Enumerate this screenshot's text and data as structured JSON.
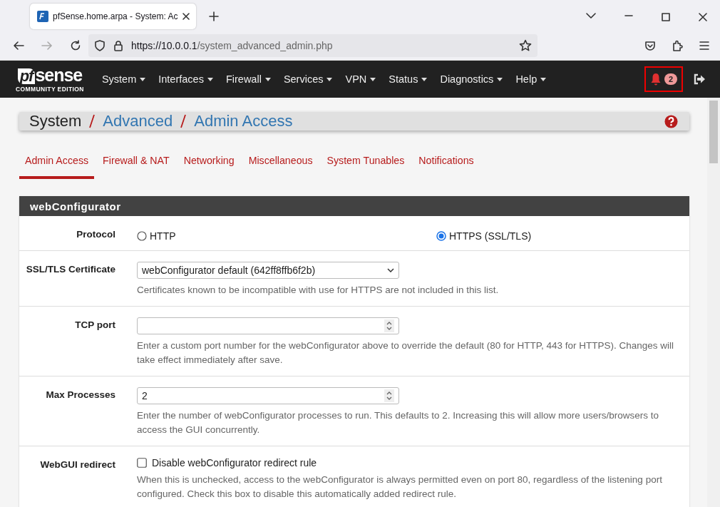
{
  "browser": {
    "tab_title": "pfSense.home.arpa - System: Ac",
    "url_host": "https://10.0.0.1",
    "url_path": "/system_advanced_admin.php"
  },
  "logo": {
    "mark": "pf",
    "word": "sense",
    "subtitle": "COMMUNITY EDITION"
  },
  "nav": {
    "menus": [
      "System",
      "Interfaces",
      "Firewall",
      "Services",
      "VPN",
      "Status",
      "Diagnostics",
      "Help"
    ],
    "notifications": "2"
  },
  "breadcrumb": [
    {
      "label": "System",
      "kind": "text"
    },
    {
      "label": "Advanced",
      "kind": "link"
    },
    {
      "label": "Admin Access",
      "kind": "link"
    }
  ],
  "tabs": [
    {
      "label": "Admin Access",
      "selected": true
    },
    {
      "label": "Firewall & NAT",
      "selected": false
    },
    {
      "label": "Networking",
      "selected": false
    },
    {
      "label": "Miscellaneous",
      "selected": false
    },
    {
      "label": "System Tunables",
      "selected": false
    },
    {
      "label": "Notifications",
      "selected": false
    }
  ],
  "section": {
    "title": "webConfigurator",
    "rows": [
      {
        "kind": "radio",
        "label": "Protocol",
        "options": [
          {
            "label": "HTTP",
            "selected": false
          },
          {
            "label": "HTTPS (SSL/TLS)",
            "selected": true
          }
        ]
      },
      {
        "kind": "select",
        "label": "SSL/TLS Certificate",
        "value": "webConfigurator default (642ff8ffb6f2b)",
        "help": "Certificates known to be incompatible with use for HTTPS are not included in this list."
      },
      {
        "kind": "number",
        "label": "TCP port",
        "help": "Enter a custom port number for the webConfigurator above to override the default (80 for HTTP, 443 for HTTPS). Changes will take effect immediately after save."
      },
      {
        "kind": "number",
        "label": "Max Processes",
        "value": "2",
        "help": "Enter the number of webConfigurator processes to run. This defaults to 2. Increasing this will allow more users/browsers to access the GUI concurrently."
      },
      {
        "kind": "checkbox",
        "label": "WebGUI redirect",
        "text": "Disable webConfigurator redirect rule",
        "checked": false,
        "help": "When this is unchecked, access to the webConfigurator is always permitted even on port 80, regardless of the listening port configured. Check this box to disable this automatically added redirect rule."
      }
    ]
  }
}
